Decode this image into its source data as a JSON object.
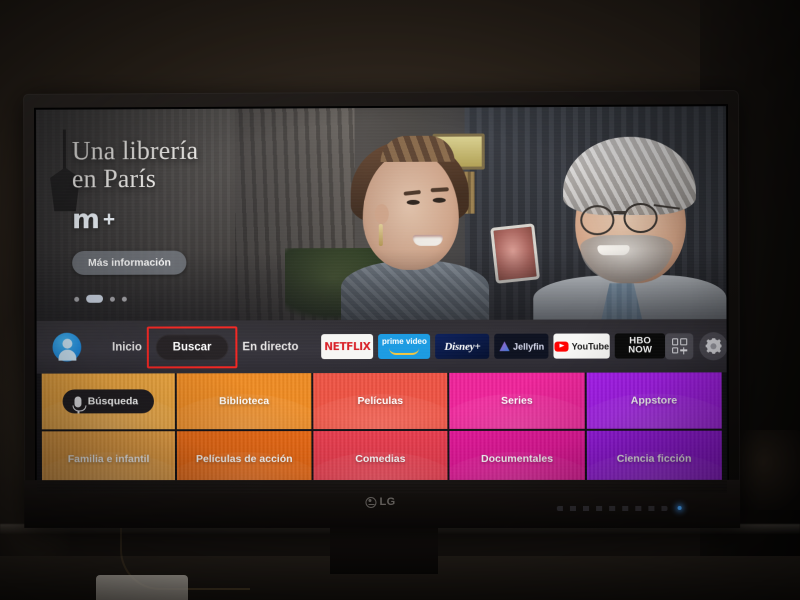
{
  "device": {
    "brand": "LG",
    "brand_mark_icon": "lg-circle-logo"
  },
  "hero": {
    "title": "Una librería\nen París",
    "brand_logo_text": "m",
    "brand_logo_plus": "+",
    "brand_logo_icon": "movistar-plus-logo",
    "more_info_label": "Más información",
    "carousel_dots": 4,
    "carousel_active_index": 1
  },
  "navbar": {
    "avatar_icon": "user-avatar-icon",
    "links": [
      {
        "label": "Inicio",
        "selected": false
      },
      {
        "label": "Buscar",
        "selected": true,
        "highlighted": true
      },
      {
        "label": "En directo",
        "selected": false
      }
    ],
    "apps": [
      {
        "name": "Netflix",
        "label": "NETFLIX",
        "icon": "netflix-logo",
        "bg": "#f6f6f4",
        "fg": "#d81f26"
      },
      {
        "name": "Prime Video",
        "label": "prime video",
        "icon": "prime-video-logo",
        "bg": "#1a9ae1",
        "fg": "#ffffff"
      },
      {
        "name": "Disney+",
        "label": "Disney+",
        "icon": "disney-plus-logo",
        "bg": "#081539",
        "fg": "#ffffff"
      },
      {
        "name": "Jellyfin",
        "label": "Jellyfin",
        "icon": "jellyfin-logo",
        "bg": "#0d1120",
        "fg": "#d9dcf0"
      },
      {
        "name": "YouTube",
        "label": "YouTube",
        "icon": "youtube-logo",
        "bg": "#f7f7f5",
        "fg": "#1b1b1b"
      },
      {
        "name": "HBO NOW",
        "label_line1": "HBO",
        "label_line2": "NOW",
        "icon": "hbo-now-logo",
        "bg": "#0a0a0a",
        "fg": "#ffffff"
      }
    ],
    "apps_button_icon": "apps-grid-plus-icon",
    "settings_button_icon": "gear-icon"
  },
  "tiles": {
    "row1": [
      {
        "label": "Búsqueda",
        "is_search": true,
        "highlighted": true,
        "icon": "microphone-icon",
        "color": "#f0a63c"
      },
      {
        "label": "Biblioteca",
        "color": "#ef8a20"
      },
      {
        "label": "Películas",
        "color": "#ef5242"
      },
      {
        "label": "Series",
        "color": "#f0229a"
      },
      {
        "label": "Appstore",
        "color": "#a81bf0"
      }
    ],
    "row2": [
      {
        "label": "Familia e infantil",
        "color": "#eda243"
      },
      {
        "label": "Películas de acción",
        "color": "#ef6a12"
      },
      {
        "label": "Comedias",
        "color": "#ef3d4f"
      },
      {
        "label": "Documentales",
        "color": "#e8159b"
      },
      {
        "label": "Ciencia ficción",
        "color": "#9b17e8"
      }
    ],
    "row3_placeholder_count": 5,
    "row3_color": "#737c88"
  },
  "annotations": {
    "highlight_color": "#f4231f",
    "highlighted_elements": [
      "Buscar",
      "Búsqueda"
    ]
  }
}
